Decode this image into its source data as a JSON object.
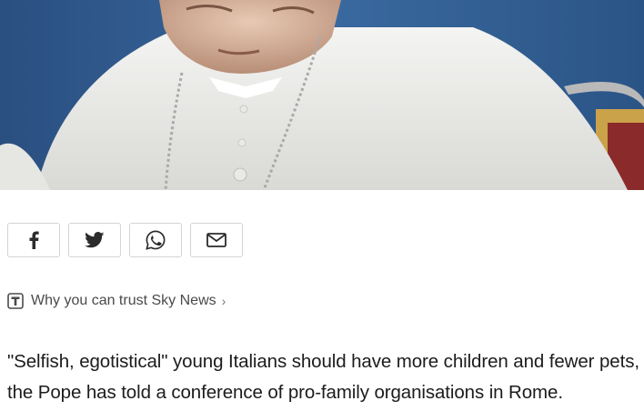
{
  "hero": {
    "image_icon": "photo-pope"
  },
  "share": {
    "buttons": [
      {
        "icon": "facebook-icon"
      },
      {
        "icon": "twitter-icon"
      },
      {
        "icon": "whatsapp-icon"
      },
      {
        "icon": "email-icon"
      }
    ]
  },
  "trust": {
    "label": "Why you can trust Sky News",
    "chevron": "›",
    "icon": "trust-badge-icon"
  },
  "article": {
    "lead": "\"Selfish, egotistical\" young Italians should have more children and fewer pets, the Pope has told a conference of pro-family organisations in Rome."
  },
  "colors": {
    "background": "#2f5b8d",
    "text": "#1c1c1c",
    "muted": "#4a4a4a",
    "border": "#d4d4d4"
  }
}
